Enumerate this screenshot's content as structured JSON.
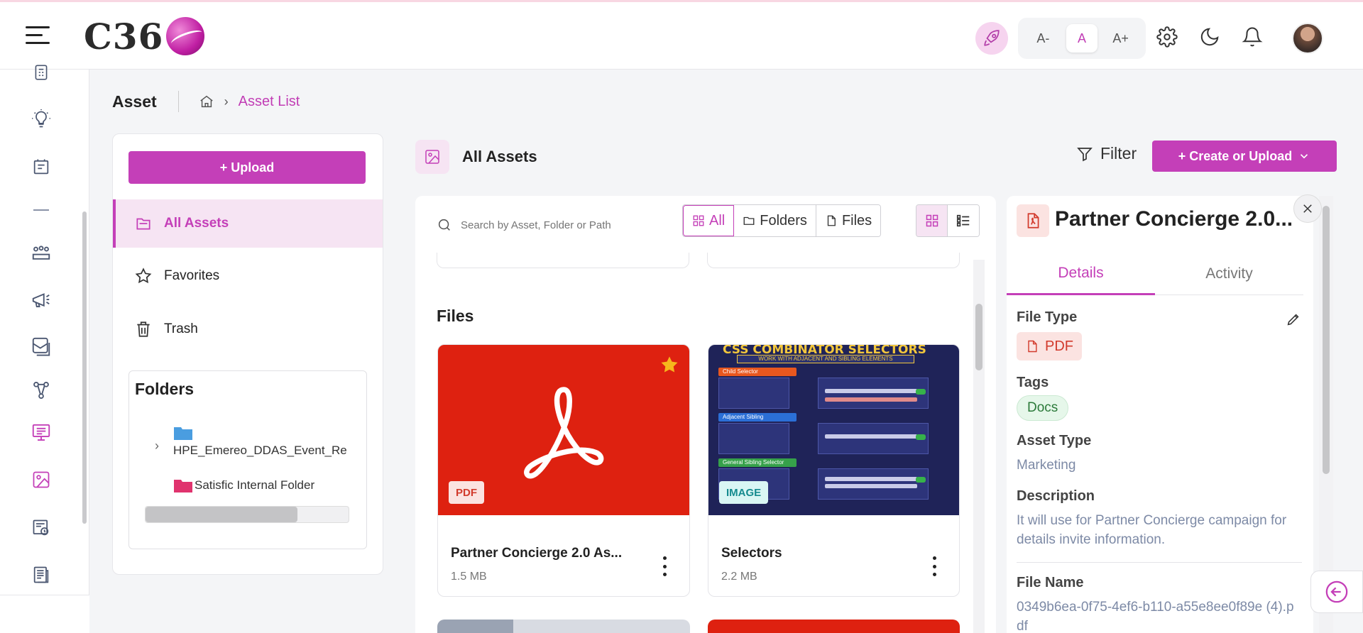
{
  "header": {
    "logo_text": "C36",
    "font_controls": [
      "A-",
      "A",
      "A+"
    ],
    "font_active": "A"
  },
  "breadcrumb": {
    "title": "Asset",
    "current": "Asset List"
  },
  "left_panel": {
    "upload_label": "+ Upload",
    "nav": [
      {
        "label": "All Assets",
        "icon": "folder-icon",
        "active": true
      },
      {
        "label": "Favorites",
        "icon": "star-icon",
        "active": false
      },
      {
        "label": "Trash",
        "icon": "trash-icon",
        "active": false
      }
    ],
    "folders_title": "Folders",
    "folders": [
      {
        "name": "HPE_Emereo_DDAS_Event_Re",
        "color": "#4a9de0"
      },
      {
        "name": "Satisfic Internal Folder",
        "color": "#e0336e"
      }
    ]
  },
  "main": {
    "title": "All Assets",
    "filter_label": "Filter",
    "create_label": "+ Create or Upload",
    "search_placeholder": "Search by Asset, Folder or Path",
    "segments": [
      "All",
      "Folders",
      "Files"
    ],
    "segment_active": "All",
    "files_heading": "Files",
    "files": [
      {
        "name": "Partner Concierge 2.0 As...",
        "size": "1.5 MB",
        "type": "PDF",
        "favorite": true
      },
      {
        "name": "Selectors",
        "size": "2.2 MB",
        "type": "IMAGE",
        "favorite": false
      }
    ],
    "thumbnail_text": {
      "title": "CSS COMBINATOR SELECTORS",
      "subtitle": "WORK WITH ADJACENT AND SIBLING ELEMENTS",
      "row_labels": [
        "Child Selector",
        "Adjacent Sibling",
        "General Sibling Selector"
      ]
    }
  },
  "details": {
    "title": "Partner Concierge 2.0...",
    "tabs": [
      "Details",
      "Activity"
    ],
    "tab_active": "Details",
    "file_type_label": "File Type",
    "file_type_value": "PDF",
    "tags_label": "Tags",
    "tags": [
      "Docs"
    ],
    "asset_type_label": "Asset Type",
    "asset_type_value": "Marketing",
    "description_label": "Description",
    "description_value": "It will use for Partner Concierge campaign for details invite information.",
    "file_name_label": "File Name",
    "file_name_value": "0349b6ea-0f75-4ef6-b110-a55e8ee0f89e (4).pdf"
  },
  "colors": {
    "accent": "#c43fb8",
    "accent_light": "#f6e4f3",
    "pdf_red": "#de2110"
  }
}
